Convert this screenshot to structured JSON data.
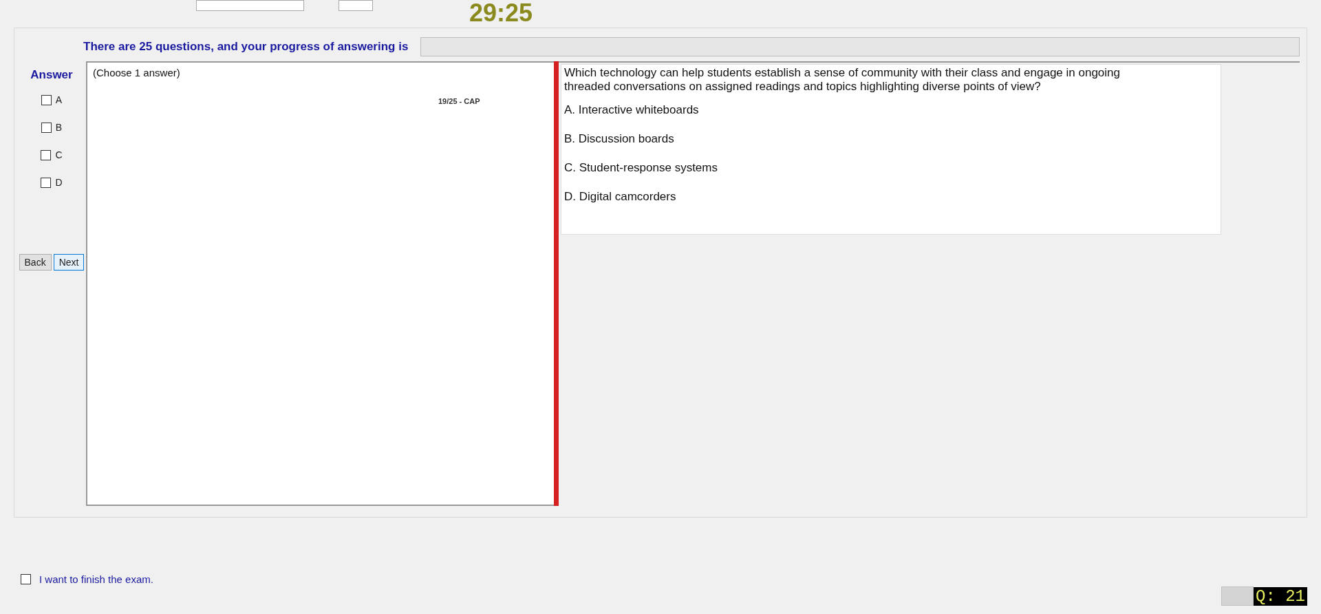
{
  "header": {
    "timer": "29:25"
  },
  "progress": {
    "label": "There are 25 questions, and your progress of answering is",
    "level": 0
  },
  "answer": {
    "title": "Answer",
    "options": [
      {
        "label": "A",
        "checked": false
      },
      {
        "label": "B",
        "checked": false
      },
      {
        "label": "C",
        "checked": false
      },
      {
        "label": "D",
        "checked": false
      }
    ]
  },
  "buttons": [
    {
      "label": "Back",
      "selected": false
    },
    {
      "label": "Next",
      "selected": true
    }
  ],
  "answer_panel": {
    "hint": "(Choose 1 answer)",
    "tag": "19/25 - CAP"
  },
  "question": {
    "text": "Which technology can help students establish a sense of community with their class and engage in ongoing threaded conversations on assigned readings and topics highlighting diverse points of view?",
    "choices": [
      "A.  Interactive whiteboards",
      "B.  Discussion boards",
      "C.  Student-response systems",
      "D.  Digital camcorders"
    ]
  },
  "finish": {
    "label": "I want to finish the exam.",
    "checked": false
  },
  "counter": "Q: 21"
}
